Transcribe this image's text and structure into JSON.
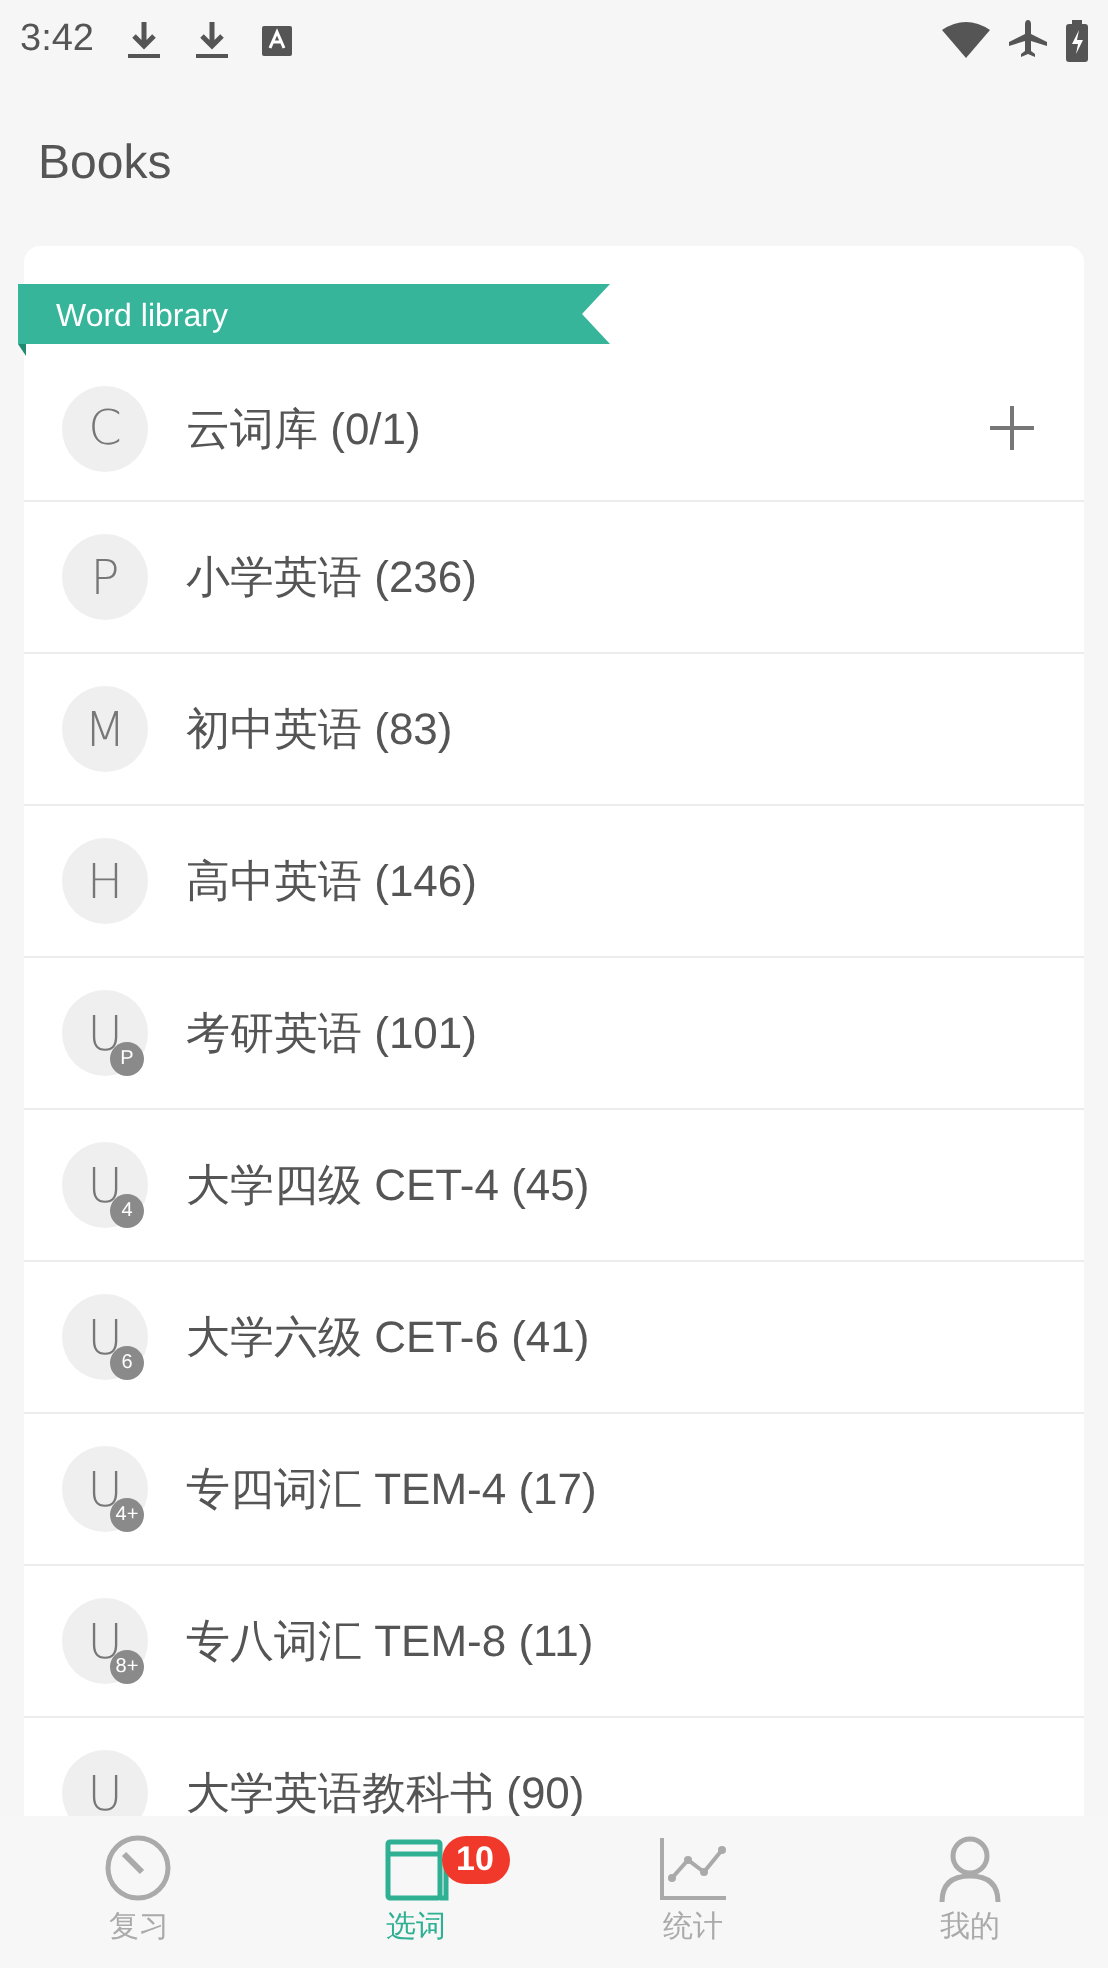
{
  "status_bar": {
    "time": "3:42"
  },
  "title": "Books",
  "banner": "Word library",
  "books": [
    {
      "letter": "C",
      "name": "云词库 (0/1)",
      "addable": true
    },
    {
      "letter": "P",
      "name": "小学英语 (236)",
      "addable": false
    },
    {
      "letter": "M",
      "name": "初中英语 (83)",
      "addable": false
    },
    {
      "letter": "H",
      "name": "高中英语 (146)",
      "addable": false
    },
    {
      "letter": "U",
      "badge": "P",
      "name": "考研英语 (101)",
      "addable": false
    },
    {
      "letter": "U",
      "badge": "4",
      "name": "大学四级 CET-4 (45)",
      "addable": false
    },
    {
      "letter": "U",
      "badge": "6",
      "name": "大学六级 CET-6 (41)",
      "addable": false
    },
    {
      "letter": "U",
      "badge": "4+",
      "name": "专四词汇 TEM-4 (17)",
      "addable": false
    },
    {
      "letter": "U",
      "badge": "8+",
      "name": "专八词汇 TEM-8 (11)",
      "addable": false
    },
    {
      "letter": "U",
      "name": "大学英语教科书 (90)",
      "addable": false
    }
  ],
  "nav": [
    {
      "kind": "review",
      "label": "复习",
      "selected": false
    },
    {
      "kind": "pick",
      "label": "选词",
      "selected": true,
      "badge": "10"
    },
    {
      "kind": "stats",
      "label": "统计",
      "selected": false
    },
    {
      "kind": "me",
      "label": "我的",
      "selected": false
    }
  ]
}
